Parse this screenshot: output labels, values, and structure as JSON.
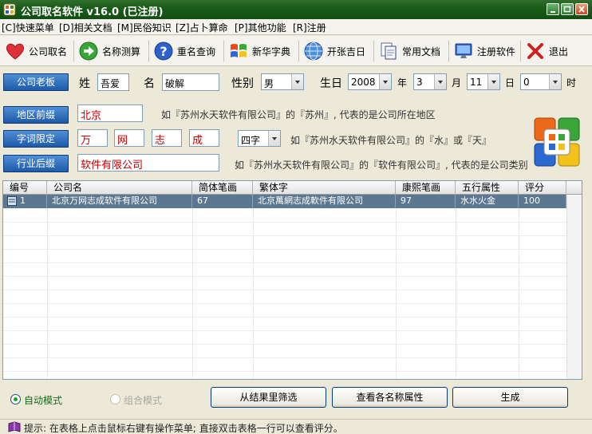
{
  "window": {
    "title": "公司取名软件 v16.0 (已注册)"
  },
  "menu": [
    "[C]快速菜单",
    "[D]相关文档",
    "[M]民俗知识",
    "[Z]占卜算命",
    "[P]其他功能",
    "[R]注册"
  ],
  "toolbar": [
    "公司取名",
    "名称测算",
    "重名查询",
    "新华字典",
    "开张吉日",
    "常用文档",
    "注册软件",
    "退出"
  ],
  "boss": {
    "button": "公司老板",
    "surname_label": "姓",
    "surname": "吾爱",
    "name_label": "名",
    "name": "破解",
    "gender_label": "性别",
    "gender": "男",
    "birthday_label": "生日",
    "year": "2008",
    "year_label": "年",
    "month": "3",
    "month_label": "月",
    "day": "11",
    "day_label": "日",
    "hour": "0",
    "hour_label": "时"
  },
  "region": {
    "button": "地区前缀",
    "value": "北京",
    "hint": "如『苏州水天软件有限公司』的『苏州』, 代表的是公司所在地区"
  },
  "chars": {
    "button": "字词限定",
    "values": [
      "万",
      "网",
      "志",
      "成"
    ],
    "length": "四字",
    "hint": "如『苏州水天软件有限公司』的『水』或『天』"
  },
  "suffix": {
    "button": "行业后缀",
    "value": "软件有限公司",
    "hint": "如『苏州水天软件有限公司』的『软件有限公司』, 代表的是公司类别"
  },
  "table": {
    "columns": [
      "编号",
      "公司名",
      "简体笔画",
      "繁体字",
      "康熙笔画",
      "五行属性",
      "评分"
    ],
    "rows": [
      [
        "1",
        "北京万网志成软件有限公司",
        "67",
        "北京萬網志成軟件有限公司",
        "97",
        "水水火金",
        "100"
      ]
    ]
  },
  "modes": {
    "auto": "自动模式",
    "combo": "组合模式"
  },
  "actions": {
    "filter": "从结果里筛选",
    "view_attrs": "查看各名称属性",
    "generate": "生成"
  },
  "status": {
    "text": "提示: 在表格上点击鼠标右键有操作菜单; 直接双击表格一行可以查看评分。"
  },
  "colors": {
    "title_bar": "#1a5c1a",
    "blue_button": "#2b6cc4",
    "selected_row": "#5c7891",
    "input_text_red": "#c00000"
  }
}
